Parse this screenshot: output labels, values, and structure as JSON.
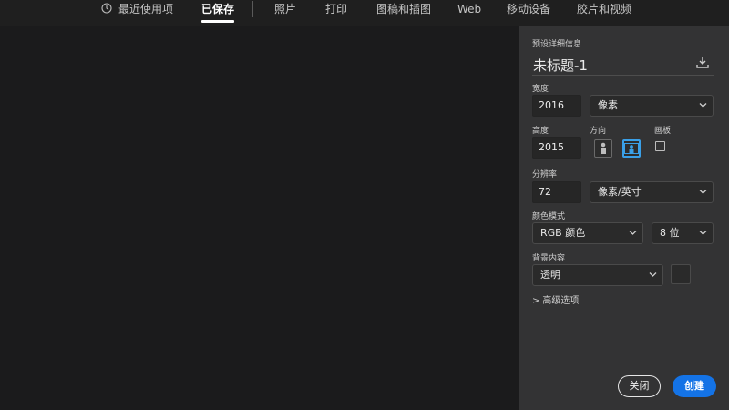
{
  "tabs": [
    {
      "label": "最近使用项",
      "icon": "clock-icon"
    },
    {
      "label": "已保存",
      "active": true
    },
    {
      "label": "照片"
    },
    {
      "label": "打印"
    },
    {
      "label": "图稿和插图"
    },
    {
      "label": "Web"
    },
    {
      "label": "移动设备"
    },
    {
      "label": "胶片和视频"
    }
  ],
  "panel": {
    "section_label": "预设详细信息",
    "doc_title": "未标题-1",
    "save_icon": "save-preset-icon",
    "width": {
      "label": "宽度",
      "value": "2016",
      "unit": "像素"
    },
    "height": {
      "label": "高度",
      "value": "2015"
    },
    "orientation": {
      "label": "方向",
      "selected": "landscape"
    },
    "artboard": {
      "label": "画板",
      "checked": false
    },
    "resolution": {
      "label": "分辨率",
      "value": "72",
      "unit": "像素/英寸"
    },
    "color_mode": {
      "label": "颜色模式",
      "mode": "RGB 颜色",
      "depth": "8 位"
    },
    "background": {
      "label": "背景内容",
      "value": "透明"
    },
    "advanced": {
      "arrow": ">",
      "label": "高级选项"
    },
    "buttons": {
      "close": "关闭",
      "create": "创建"
    }
  },
  "colors": {
    "accent": "#1473e6",
    "orientation_selected": "#3aa0e8",
    "panel_bg": "#333334",
    "canvas_bg": "#1b1b1c"
  }
}
